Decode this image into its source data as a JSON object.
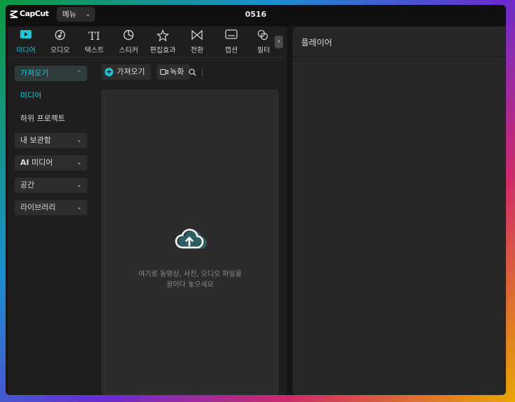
{
  "app": {
    "logo_text": "CapCut",
    "menu_label": "메뉴",
    "project_title": "0516"
  },
  "toolbar": {
    "items": [
      {
        "label": "미디어",
        "icon": "media-icon"
      },
      {
        "label": "오디오",
        "icon": "audio-icon"
      },
      {
        "label": "텍스트",
        "icon": "text-icon"
      },
      {
        "label": "스티커",
        "icon": "sticker-icon"
      },
      {
        "label": "편집효과",
        "icon": "effects-icon"
      },
      {
        "label": "전환",
        "icon": "transition-icon"
      },
      {
        "label": "캡션",
        "icon": "caption-icon"
      },
      {
        "label": "필터",
        "icon": "filter-icon"
      }
    ],
    "active_color": "#1ec8d6"
  },
  "sidebar": {
    "import_group": "가져오기",
    "links": [
      "미디어",
      "하위 프로젝트"
    ],
    "my_library": "내 보관함",
    "ai_media_prefix": "AI",
    "ai_media_label": "미디어",
    "space": "공간",
    "library": "라이브러리"
  },
  "media": {
    "import_button": "가져오기",
    "record_button": "녹화",
    "drop_hint_line1": "여기로 동영상, 사진, 오디오 파일을",
    "drop_hint_line2": "끌어다 놓으세요"
  },
  "player": {
    "title": "플레이어"
  }
}
